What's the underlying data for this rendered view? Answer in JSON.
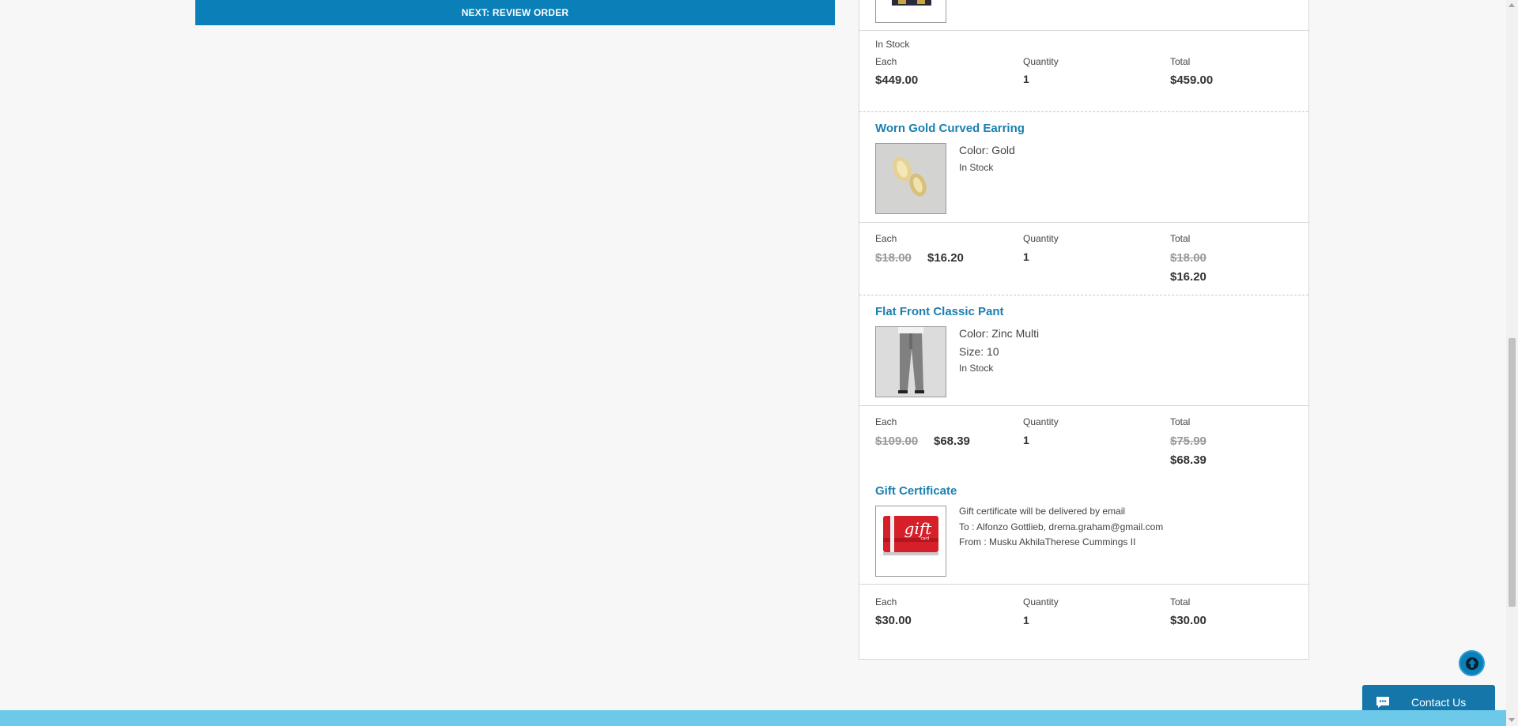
{
  "checkout": {
    "next_button_label": "NEXT: REVIEW ORDER"
  },
  "labels": {
    "each": "Each",
    "quantity": "Quantity",
    "total": "Total"
  },
  "items": [
    {
      "stock": "In Stock",
      "each_price": "$449.00",
      "quantity": "1",
      "total": "$459.00"
    },
    {
      "name": "Worn Gold Curved Earring",
      "attributes": [
        "Color: Gold"
      ],
      "stock": "In Stock",
      "each_original": "$18.00",
      "each_price": "$16.20",
      "quantity": "1",
      "total_original": "$18.00",
      "total": "$16.20"
    },
    {
      "name": "Flat Front Classic Pant",
      "attributes": [
        "Color: Zinc Multi",
        "Size: 10"
      ],
      "stock": "In Stock",
      "each_original": "$109.00",
      "each_price": "$68.39",
      "quantity": "1",
      "total_original": "$75.99",
      "total": "$68.39"
    },
    {
      "name": "Gift Certificate",
      "gift_lines": [
        "Gift certificate will be delivered by email",
        "To : Alfonzo Gottlieb, drema.graham@gmail.com",
        "From : Musku AkhilaTherese Cummings II"
      ],
      "image_text": "gift",
      "image_subtext": "card",
      "each_price": "$30.00",
      "quantity": "1",
      "total": "$30.00"
    }
  ],
  "widgets": {
    "contact_label": "Contact Us"
  },
  "colors": {
    "accent": "#0b80b8",
    "link": "#1a7fb0",
    "footer": "#6cc9ea",
    "contact": "#1576a9"
  },
  "icons": [
    "arrow-up-icon",
    "chat-bubble-icon",
    "gift-card-image",
    "earring-image",
    "pant-image"
  ]
}
